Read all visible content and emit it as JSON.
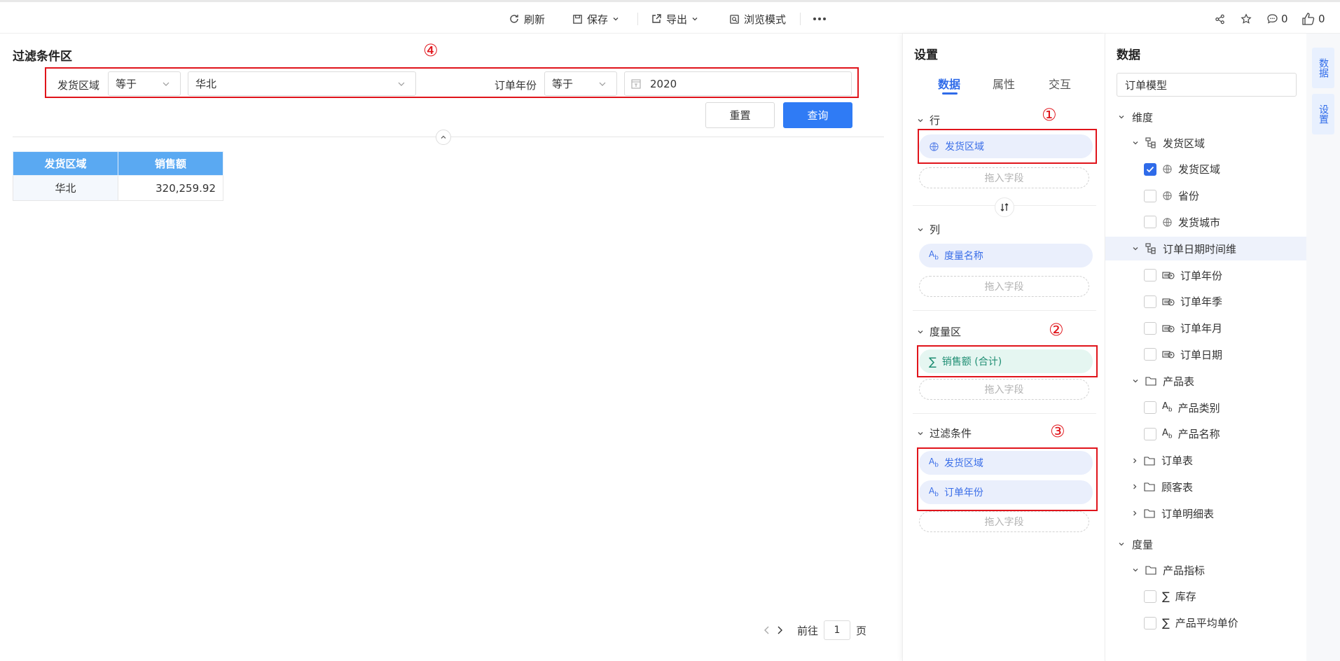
{
  "toolbar": {
    "refresh": "刷新",
    "save": "保存",
    "export": "导出",
    "preview": "浏览模式",
    "comments": "0",
    "likes": "0"
  },
  "filter_area": {
    "title": "过滤条件区",
    "marker": "④",
    "filter1": {
      "label": "发货区域",
      "operator": "等于",
      "value": "华北"
    },
    "filter2": {
      "label": "订单年份",
      "operator": "等于",
      "value": "2020"
    },
    "reset": "重置",
    "query": "查询"
  },
  "table": {
    "headers": [
      "发货区域",
      "销售额"
    ],
    "rows": [
      [
        "华北",
        "320,259.92"
      ]
    ]
  },
  "pager": {
    "prefix": "前往",
    "page": "1",
    "suffix": "页"
  },
  "settings": {
    "title": "设置",
    "tabs": [
      "数据",
      "属性",
      "交互"
    ],
    "rows": {
      "label": "行",
      "marker": "①",
      "field": "发货区域",
      "drop": "拖入字段"
    },
    "columns": {
      "label": "列",
      "field": "度量名称",
      "drop": "拖入字段"
    },
    "measures": {
      "label": "度量区",
      "marker": "②",
      "field": "销售额 (合计)",
      "drop": "拖入字段"
    },
    "filters": {
      "label": "过滤条件",
      "marker": "③",
      "fields": [
        "发货区域",
        "订单年份"
      ],
      "drop": "拖入字段"
    }
  },
  "data_panel": {
    "title": "数据",
    "model": "订单模型",
    "dimension_label": "维度",
    "measure_label": "度量",
    "tree": [
      {
        "text": "发货区域",
        "level": 1,
        "kind": "hier",
        "expanded": true
      },
      {
        "text": "发货区域",
        "level": 2,
        "kind": "geo",
        "checked": true
      },
      {
        "text": "省份",
        "level": 2,
        "kind": "geo",
        "checked": false
      },
      {
        "text": "发货城市",
        "level": 2,
        "kind": "geo",
        "checked": false
      },
      {
        "text": "订单日期时间维",
        "level": 1,
        "kind": "hier",
        "expanded": true
      },
      {
        "text": "订单年份",
        "level": 2,
        "kind": "date",
        "checked": false
      },
      {
        "text": "订单年季",
        "level": 2,
        "kind": "date",
        "checked": false
      },
      {
        "text": "订单年月",
        "level": 2,
        "kind": "date",
        "checked": false
      },
      {
        "text": "订单日期",
        "level": 2,
        "kind": "date",
        "checked": false
      },
      {
        "text": "产品表",
        "level": 1,
        "kind": "folder",
        "expanded": true
      },
      {
        "text": "产品类别",
        "level": 2,
        "kind": "text",
        "checked": false
      },
      {
        "text": "产品名称",
        "level": 2,
        "kind": "text",
        "checked": false
      },
      {
        "text": "订单表",
        "level": 1,
        "kind": "folder",
        "expanded": false
      },
      {
        "text": "顾客表",
        "level": 1,
        "kind": "folder",
        "expanded": false
      },
      {
        "text": "订单明细表",
        "level": 1,
        "kind": "folder",
        "expanded": false
      }
    ],
    "measure_tree": [
      {
        "text": "产品指标",
        "level": 1,
        "kind": "folder",
        "expanded": true
      },
      {
        "text": "库存",
        "level": 2,
        "kind": "sum",
        "checked": false
      },
      {
        "text": "产品平均单价",
        "level": 2,
        "kind": "sum",
        "checked": false
      }
    ]
  },
  "side_tabs": [
    "数据",
    "设置"
  ]
}
